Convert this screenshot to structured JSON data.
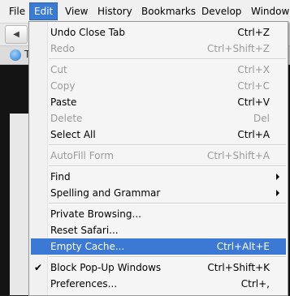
{
  "menubar": {
    "items": [
      "File",
      "Edit",
      "View",
      "History",
      "Bookmarks",
      "Develop",
      "Window"
    ]
  },
  "tab": {
    "title": "T"
  },
  "edit_menu": {
    "items": [
      {
        "label": "Undo Close Tab",
        "shortcut": "Ctrl+Z",
        "enabled": true
      },
      {
        "label": "Redo",
        "shortcut": "Ctrl+Shift+Z",
        "enabled": false
      },
      {
        "label": "Cut",
        "shortcut": "Ctrl+X",
        "enabled": false
      },
      {
        "label": "Copy",
        "shortcut": "Ctrl+C",
        "enabled": false
      },
      {
        "label": "Paste",
        "shortcut": "Ctrl+V",
        "enabled": true
      },
      {
        "label": "Delete",
        "shortcut": "Del",
        "enabled": false
      },
      {
        "label": "Select All",
        "shortcut": "Ctrl+A",
        "enabled": true
      },
      {
        "label": "AutoFill Form",
        "shortcut": "Ctrl+Shift+A",
        "enabled": false
      },
      {
        "label": "Find",
        "shortcut": "",
        "enabled": true,
        "submenu": true
      },
      {
        "label": "Spelling and Grammar",
        "shortcut": "",
        "enabled": true,
        "submenu": true
      },
      {
        "label": "Private Browsing...",
        "shortcut": "",
        "enabled": true
      },
      {
        "label": "Reset Safari...",
        "shortcut": "",
        "enabled": true
      },
      {
        "label": "Empty Cache...",
        "shortcut": "Ctrl+Alt+E",
        "enabled": true,
        "highlighted": true
      },
      {
        "label": "Block Pop-Up Windows",
        "shortcut": "Ctrl+Shift+K",
        "enabled": true,
        "checked": true
      },
      {
        "label": "Preferences...",
        "shortcut": "Ctrl+,",
        "enabled": true
      }
    ]
  }
}
